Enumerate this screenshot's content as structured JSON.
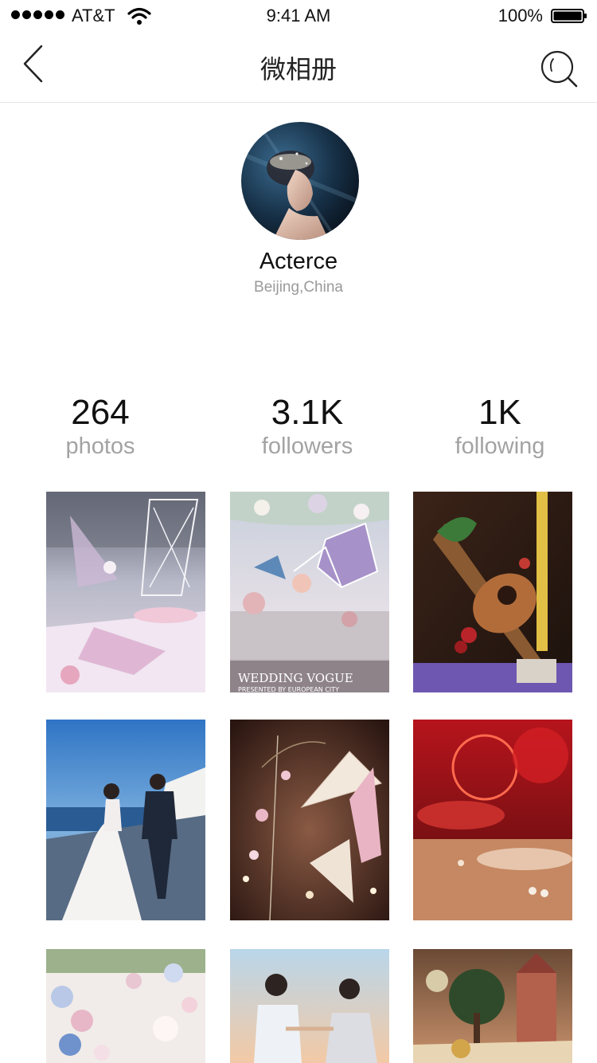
{
  "status_bar": {
    "carrier": "AT&T",
    "time": "9:41 AM",
    "battery": "100%"
  },
  "nav": {
    "title": "微相册",
    "back_icon": "chevron-left-icon",
    "search_icon": "search-icon"
  },
  "profile": {
    "name": "Acterce",
    "location": "Beijing,China"
  },
  "stats": [
    {
      "value": "264",
      "label": "photos"
    },
    {
      "value": "3.1K",
      "label": "followers"
    },
    {
      "value": "1K",
      "label": "following"
    }
  ],
  "photos": [
    {
      "subject": "wedding stage with geometric sculpture"
    },
    {
      "subject": "wedding banquet hall",
      "caption": "WEDDING VOGUE",
      "subcaption": "PRESENTED BY EUROPEAN CITY"
    },
    {
      "subject": "floral violin decoration"
    },
    {
      "subject": "bride and groom by the sea"
    },
    {
      "subject": "hanging paper fans"
    },
    {
      "subject": "red glassware table setting"
    },
    {
      "subject": "floral aisle"
    },
    {
      "subject": "couple at sunset"
    },
    {
      "subject": "fairytale castle decoration"
    }
  ],
  "colors": {
    "divider": "#e6e6e6",
    "muted_text": "#a3a3a3"
  }
}
